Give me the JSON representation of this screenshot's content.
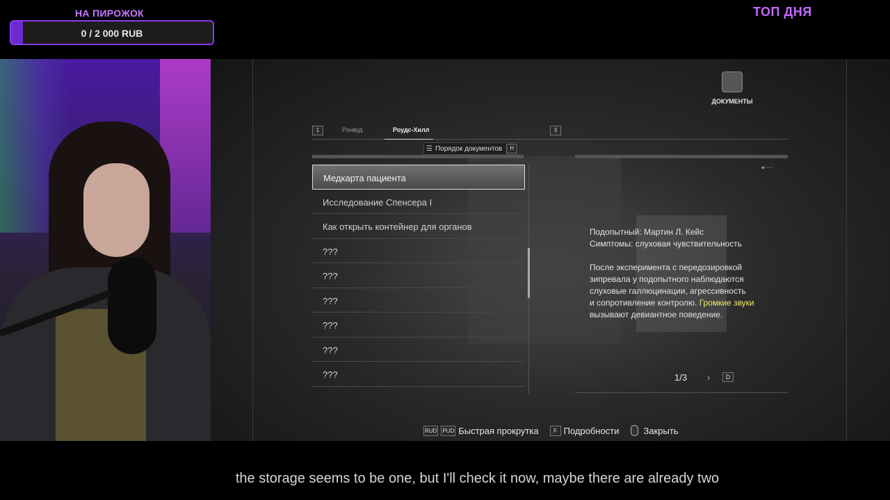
{
  "donation": {
    "title": "НА ПИРОЖОК",
    "amount": "0 / 2 000 RUB",
    "progress": 0.06
  },
  "top_day": "ТОП ДНЯ",
  "game": {
    "documents_label": "ДОКУМЕНТЫ",
    "tabs": {
      "left_key": "1",
      "right_key": "3",
      "items": [
        "Рэнвуд",
        "Роудс-Хилл"
      ],
      "active": "Роудс-Хилл"
    },
    "sort": {
      "label": "Порядок документов",
      "key": "H"
    },
    "documents": [
      "Медкарта пациента",
      "Исследование Спенсера I",
      "Как открыть контейнер для органов",
      "???",
      "???",
      "???",
      "???",
      "???",
      "???"
    ],
    "selected_index": 0,
    "document_text": {
      "line1": "Подопытный: Мартин Л. Кейс",
      "line2": "Симптомы: слуховая чувствительность",
      "para_a": "После эксперимента с передозировкой",
      "para_b": "зипревала у подопытного наблюдаются",
      "para_c": "слуховые галлюцинации, агрессивность",
      "para_d": "и сопротивление контролю.",
      "highlight": "Громкие звуки",
      "para_e": "вызывают девиантное поведение."
    },
    "page": "1/3",
    "next_key": "D",
    "controls": [
      {
        "keys": [
          "RUD",
          "PUD"
        ],
        "label": "Быстрая прокрутка"
      },
      {
        "keys": [
          "F"
        ],
        "label": "Подробности"
      },
      {
        "keys": [
          "mouse"
        ],
        "label": "Закрыть"
      }
    ]
  },
  "subtitle": "the storage seems to be one, but I'll check it now, maybe there are already two",
  "colors": {
    "accent": "#8a3cf0",
    "highlight": "#f1ec6c"
  }
}
